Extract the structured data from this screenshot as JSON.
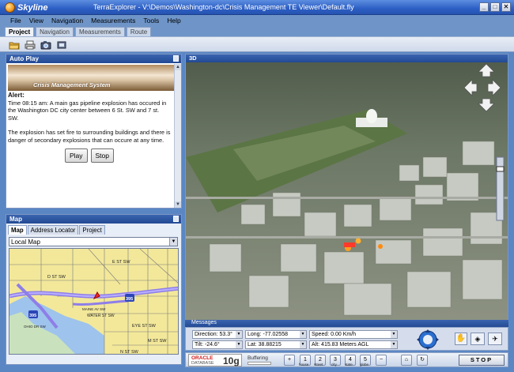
{
  "app": {
    "logo_text": "Skyline",
    "title": "TerraExplorer - V:\\Demos\\Washington-dc\\Crisis Management TE Viewer\\Default.fly"
  },
  "window_buttons": [
    "_",
    "□",
    "✕"
  ],
  "menu": [
    "File",
    "View",
    "Navigation",
    "Measurements",
    "Tools",
    "Help"
  ],
  "tabs": [
    "Project",
    "Navigation",
    "Measurements",
    "Route"
  ],
  "active_tab": "Project",
  "toolbar_icons": [
    "open-folder-icon",
    "print-icon",
    "camera-icon",
    "settings-icon"
  ],
  "autoplay": {
    "title": "Auto Play",
    "banner": "Crisis Management System",
    "alert_header": "Alert:",
    "alert_p1": "Time 08:15 am: A main gas pipeline explosion has occured in the Washington DC city center between 6 St. SW and 7 st. SW.",
    "alert_p2": "The explosion has set fire to surrounding buildings and there is danger of secondary explosions that can occure at any time.",
    "play_label": "Play",
    "stop_label": "Stop"
  },
  "map_panel": {
    "title": "Map",
    "tabs": [
      "Map",
      "Address Locator",
      "Project"
    ],
    "selected_map": "Local Map",
    "labels": {
      "street1": "E ST SW",
      "street2": "D ST SW",
      "street3": "WATER ST SW",
      "street4": "EYE ST SW",
      "street5": "M ST SW",
      "street6": "N ST SW",
      "street7": "MAINE AV SW",
      "street8": "OHIO DR SW",
      "hwy": "395",
      "hwy2": "395"
    }
  },
  "view3d": {
    "title": "3D",
    "nav_arrows": [
      "up",
      "left",
      "right",
      "down"
    ]
  },
  "messages": {
    "title": "Messages"
  },
  "readouts": {
    "direction": "Direction: 53.3°",
    "tilt": "Tilt:           -24.6°",
    "long": "Long:  -77.02558",
    "lat": "Lat:     38.88215",
    "speed": "Speed: 0.00 Km/h",
    "alt": "Alt: 415.83 Meters AGL"
  },
  "bottom": {
    "oracle": "ORACLE",
    "database": "DATABASE",
    "tenG": "10g",
    "buffering": "Buffering",
    "zoom_buttons": [
      {
        "label": "1",
        "caption": "house"
      },
      {
        "label": "2",
        "caption": "street"
      },
      {
        "label": "3",
        "caption": "city"
      },
      {
        "label": "4",
        "caption": "state"
      },
      {
        "label": "5",
        "caption": "globe"
      }
    ],
    "stop": "STOP"
  }
}
